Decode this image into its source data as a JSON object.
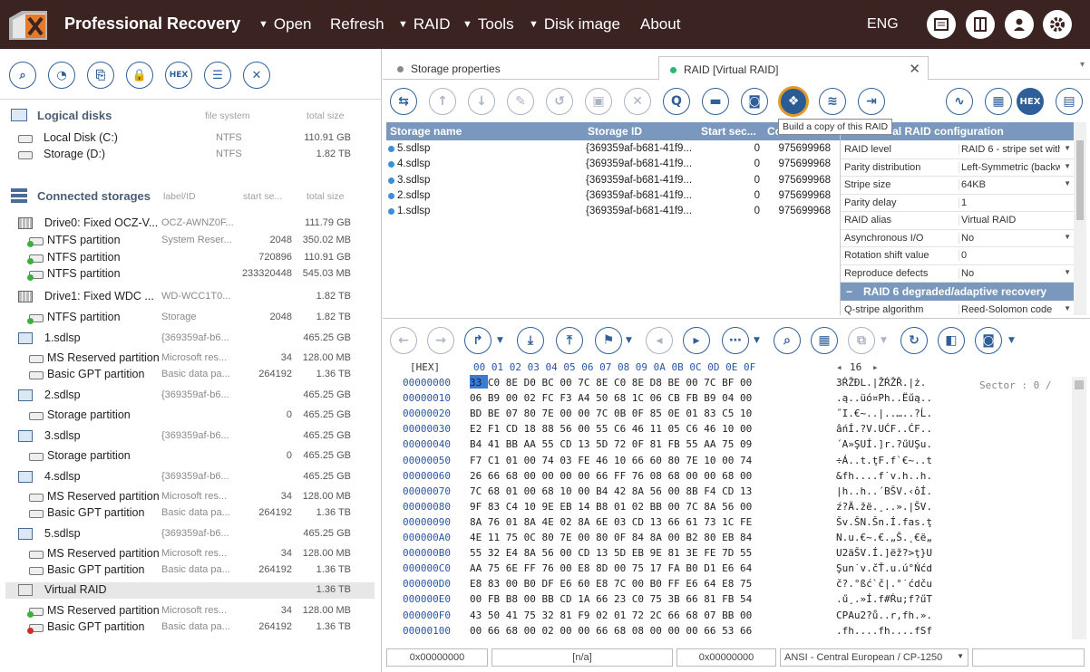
{
  "header": {
    "title": "Professional Recovery",
    "menu": [
      {
        "label": "Open",
        "arrow": true
      },
      {
        "label": "Refresh",
        "arrow": false
      },
      {
        "label": "RAID",
        "arrow": true
      },
      {
        "label": "Tools",
        "arrow": true
      },
      {
        "label": "Disk image",
        "arrow": true
      },
      {
        "label": "About",
        "arrow": false
      }
    ],
    "lang": "ENG"
  },
  "left": {
    "logical": {
      "title": "Logical disks",
      "col_fs": "file system",
      "col_size": "total size",
      "items": [
        {
          "name": "Local Disk (C:)",
          "fs": "NTFS",
          "size": "110.91 GB"
        },
        {
          "name": "Storage (D:)",
          "fs": "NTFS",
          "size": "1.82 TB"
        }
      ]
    },
    "connected": {
      "title": "Connected storages",
      "col_label": "label/ID",
      "col_start": "start se...",
      "col_size": "total size",
      "items": [
        {
          "name": "Drive0: Fixed OCZ-V...",
          "label": "OCZ-AWNZ0F...",
          "start": "",
          "size": "111.79 GB",
          "type": "drive",
          "indent": 0
        },
        {
          "name": "NTFS partition",
          "label": "System Reser...",
          "start": "2048",
          "size": "350.02 MB",
          "type": "part",
          "indent": 1
        },
        {
          "name": "NTFS partition",
          "label": "",
          "start": "720896",
          "size": "110.91 GB",
          "type": "part",
          "indent": 1
        },
        {
          "name": "NTFS partition",
          "label": "",
          "start": "233320448",
          "size": "545.03 MB",
          "type": "part",
          "indent": 1
        },
        {
          "name": "Drive1: Fixed WDC ...",
          "label": "WD-WCC1T0...",
          "start": "",
          "size": "1.82 TB",
          "type": "drive",
          "indent": 0
        },
        {
          "name": "NTFS partition",
          "label": "Storage",
          "start": "2048",
          "size": "1.82 TB",
          "type": "part",
          "indent": 1
        },
        {
          "name": "1.sdlsp",
          "label": "{369359af-b6...",
          "start": "",
          "size": "465.25 GB",
          "type": "img",
          "indent": 0
        },
        {
          "name": "MS Reserved partition",
          "label": "Microsoft res...",
          "start": "34",
          "size": "128.00 MB",
          "type": "partn",
          "indent": 1
        },
        {
          "name": "Basic GPT partition",
          "label": "Basic data pa...",
          "start": "264192",
          "size": "1.36 TB",
          "type": "partn",
          "indent": 1
        },
        {
          "name": "2.sdlsp",
          "label": "{369359af-b6...",
          "start": "",
          "size": "465.25 GB",
          "type": "img",
          "indent": 0
        },
        {
          "name": "Storage partition",
          "label": "",
          "start": "0",
          "size": "465.25 GB",
          "type": "partn",
          "indent": 1
        },
        {
          "name": "3.sdlsp",
          "label": "{369359af-b6...",
          "start": "",
          "size": "465.25 GB",
          "type": "img",
          "indent": 0
        },
        {
          "name": "Storage partition",
          "label": "",
          "start": "0",
          "size": "465.25 GB",
          "type": "partn",
          "indent": 1
        },
        {
          "name": "4.sdlsp",
          "label": "{369359af-b6...",
          "start": "",
          "size": "465.25 GB",
          "type": "img",
          "indent": 0
        },
        {
          "name": "MS Reserved partition",
          "label": "Microsoft res...",
          "start": "34",
          "size": "128.00 MB",
          "type": "partn",
          "indent": 1
        },
        {
          "name": "Basic GPT partition",
          "label": "Basic data pa...",
          "start": "264192",
          "size": "1.36 TB",
          "type": "partn",
          "indent": 1
        },
        {
          "name": "5.sdlsp",
          "label": "{369359af-b6...",
          "start": "",
          "size": "465.25 GB",
          "type": "img",
          "indent": 0
        },
        {
          "name": "MS Reserved partition",
          "label": "Microsoft res...",
          "start": "34",
          "size": "128.00 MB",
          "type": "partn",
          "indent": 1
        },
        {
          "name": "Basic GPT partition",
          "label": "Basic data pa...",
          "start": "264192",
          "size": "1.36 TB",
          "type": "partn",
          "indent": 1
        },
        {
          "name": "Virtual RAID",
          "label": "",
          "start": "",
          "size": "1.36 TB",
          "type": "raid",
          "indent": 0,
          "selected": true
        },
        {
          "name": "MS Reserved partition",
          "label": "Microsoft res...",
          "start": "34",
          "size": "128.00 MB",
          "type": "part",
          "indent": 1
        },
        {
          "name": "Basic GPT partition",
          "label": "Basic data pa...",
          "start": "264192",
          "size": "1.36 TB",
          "type": "partred",
          "indent": 1
        }
      ]
    }
  },
  "tabs": [
    {
      "label": "Storage properties",
      "dot": "#8a8a8a",
      "active": false
    },
    {
      "label": "RAID [Virtual RAID]",
      "dot": "#2bb673",
      "active": true
    }
  ],
  "tooltip": "Build a copy of this RAID",
  "hex_label": "HEX",
  "storages": {
    "cols": [
      "Storage name",
      "Storage ID",
      "Start sec...",
      "Co..."
    ],
    "rows": [
      {
        "name": "5.sdlsp",
        "id": "{369359af-b681-41f9...",
        "start": "0",
        "count": "975699968"
      },
      {
        "name": "4.sdlsp",
        "id": "{369359af-b681-41f9...",
        "start": "0",
        "count": "975699968"
      },
      {
        "name": "3.sdlsp",
        "id": "{369359af-b681-41f9...",
        "start": "0",
        "count": "975699968"
      },
      {
        "name": "2.sdlsp",
        "id": "{369359af-b681-41f9...",
        "start": "0",
        "count": "975699968"
      },
      {
        "name": "1.sdlsp",
        "id": "{369359af-b681-41f9...",
        "start": "0",
        "count": "975699968"
      }
    ]
  },
  "config": {
    "title": "Virtual RAID configuration",
    "rows": [
      {
        "k": "RAID level",
        "v": "RAID 6 - stripe set with",
        "dd": true
      },
      {
        "k": "Parity distribution",
        "v": "Left-Symmetric (backw",
        "dd": true
      },
      {
        "k": "Stripe size",
        "v": "64KB",
        "dd": true
      },
      {
        "k": "Parity delay",
        "v": "1",
        "dd": false
      },
      {
        "k": "RAID alias",
        "v": "Virtual RAID",
        "dd": false
      },
      {
        "k": "Asynchronous I/O",
        "v": "No",
        "dd": true
      },
      {
        "k": "Rotation shift value",
        "v": "0",
        "dd": false
      },
      {
        "k": "Reproduce defects",
        "v": "No",
        "dd": true
      }
    ],
    "sub": "RAID 6 degraded/adaptive recovery",
    "sub_rows": [
      {
        "k": "Q-stripe algorithm",
        "v": "Reed-Solomon code",
        "dd": true
      }
    ]
  },
  "hex": {
    "label": "[HEX]",
    "cols": "00 01 02 03 04 05 06 07 08 09 0A 0B 0C 0D 0E 0F",
    "width": "16",
    "sector": "Sector : 0 /",
    "rows": [
      {
        "o": "00000000",
        "h": "33 C0 8E D0 BC 00 7C 8E C0 8E D8 BE 00 7C BF 00",
        "a": "3ŔŽĐL.|ŽŔŽŘ.|ż."
      },
      {
        "o": "00000010",
        "h": "06 B9 00 02 FC F3 A4 50 68 1C 06 CB FB B9 04 00",
        "a": ".ą..üó¤Ph..Ëűą.."
      },
      {
        "o": "00000020",
        "h": "BD BE 07 80 7E 00 00 7C 0B 0F 85 0E 01 83 C5 10",
        "a": "˝I.€~..|..…..?Ĺ."
      },
      {
        "o": "00000030",
        "h": "E2 F1 CD 18 88 56 00 55 C6 46 11 05 C6 46 10 00",
        "a": "âńÍ.?V.UĆF..ĆF.."
      },
      {
        "o": "00000040",
        "h": "B4 41 BB AA 55 CD 13 5D 72 0F 81 FB 55 AA 75 09",
        "a": "´A»ŞUÍ.]r.?űUŞu."
      },
      {
        "o": "00000050",
        "h": "F7 C1 01 00 74 03 FE 46 10 66 60 80 7E 10 00 74",
        "a": "÷Á..t.ţF.f`€~..t"
      },
      {
        "o": "00000060",
        "h": "26 66 68 00 00 00 00 66 FF 76 08 68 00 00 68 00",
        "a": "&fh....f˙v.h..h."
      },
      {
        "o": "00000070",
        "h": "7C 68 01 00 68 10 00 B4 42 8A 56 00 8B F4 CD 13",
        "a": "|h..h..´BŠV.‹ôÍ."
      },
      {
        "o": "00000080",
        "h": "9F 83 C4 10 9E EB 14 B8 01 02 BB 00 7C 8A 56 00",
        "a": "ź?Ä.žë.¸..».|ŠV."
      },
      {
        "o": "00000090",
        "h": "8A 76 01 8A 4E 02 8A 6E 03 CD 13 66 61 73 1C FE",
        "a": "Šv.ŠN.Šn.Í.fas.ţ"
      },
      {
        "o": "000000A0",
        "h": "4E 11 75 0C 80 7E 00 80 0F 84 8A 00 B2 80 EB 84",
        "a": "N.u.€~.€.„Š.˛€ë„"
      },
      {
        "o": "000000B0",
        "h": "55 32 E4 8A 56 00 CD 13 5D EB 9E 81 3E FE 7D 55",
        "a": "U2äŠV.Í.]ëž?>ţ}U"
      },
      {
        "o": "000000C0",
        "h": "AA 75 6E FF 76 00 E8 8D 00 75 17 FA B0 D1 E6 64",
        "a": "Şun˙v.čŤ.u.ú°Ńćd"
      },
      {
        "o": "000000D0",
        "h": "E8 83 00 B0 DF E6 60 E8 7C 00 B0 FF E6 64 E8 75",
        "a": "č?.°ßć`č|.°˙ćdču"
      },
      {
        "o": "000000E0",
        "h": "00 FB B8 00 BB CD 1A 66 23 C0 75 3B 66 81 FB 54",
        "a": ".ű¸.»Í.f#Ŕu;f?űT"
      },
      {
        "o": "000000F0",
        "h": "43 50 41 75 32 81 F9 02 01 72 2C 66 68 07 BB 00",
        "a": "CPAu2?ů..r,fh.»."
      },
      {
        "o": "00000100",
        "h": "00 66 68 00 02 00 00 66 68 08 00 00 00 66 53 66",
        "a": ".fh....fh....fSf"
      }
    ]
  },
  "status": {
    "offset1": "0x00000000",
    "na": "[n/a]",
    "offset2": "0x00000000",
    "encoding": "ANSI - Central European / CP-1250"
  }
}
